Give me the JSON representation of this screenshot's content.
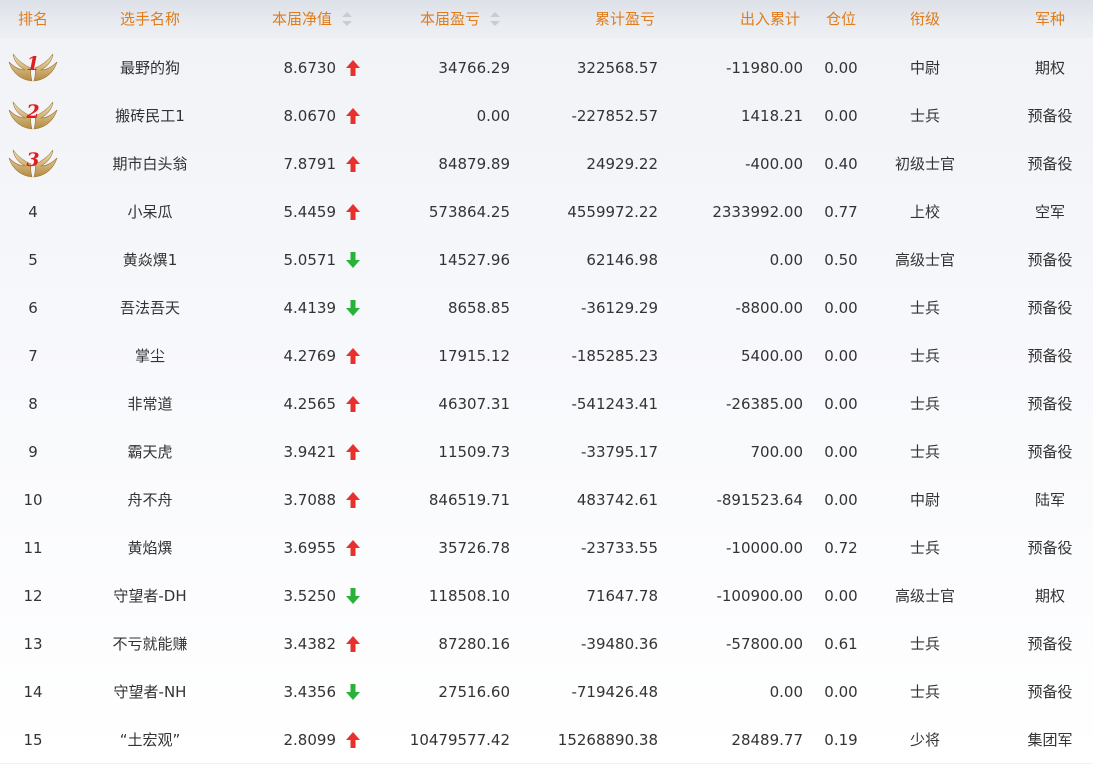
{
  "header": {
    "rank": "排名",
    "name": "选手名称",
    "nav": "本届净值",
    "pnl": "本届盈亏",
    "cum_pnl": "累计盈亏",
    "flow": "出入累计",
    "position": "仓位",
    "grade": "衔级",
    "branch": "军种"
  },
  "colors": {
    "header_text": "#e07c1a",
    "up": "#e8302c",
    "down": "#29b13a",
    "medal": "#e01e1e"
  },
  "rows": [
    {
      "rank": "1",
      "name": "最野的狗",
      "nav": "8.6730",
      "trend": "up",
      "pnl": "34766.29",
      "cum_pnl": "322568.57",
      "flow": "-11980.00",
      "position": "0.00",
      "grade": "中尉",
      "branch": "期权"
    },
    {
      "rank": "2",
      "name": "搬砖民工1",
      "nav": "8.0670",
      "trend": "up",
      "pnl": "0.00",
      "cum_pnl": "-227852.57",
      "flow": "1418.21",
      "position": "0.00",
      "grade": "士兵",
      "branch": "预备役"
    },
    {
      "rank": "3",
      "name": "期市白头翁",
      "nav": "7.8791",
      "trend": "up",
      "pnl": "84879.89",
      "cum_pnl": "24929.22",
      "flow": "-400.00",
      "position": "0.40",
      "grade": "初级士官",
      "branch": "预备役"
    },
    {
      "rank": "4",
      "name": "小呆瓜",
      "nav": "5.4459",
      "trend": "up",
      "pnl": "573864.25",
      "cum_pnl": "4559972.22",
      "flow": "2333992.00",
      "position": "0.77",
      "grade": "上校",
      "branch": "空军"
    },
    {
      "rank": "5",
      "name": "黄焱熼1",
      "nav": "5.0571",
      "trend": "down",
      "pnl": "14527.96",
      "cum_pnl": "62146.98",
      "flow": "0.00",
      "position": "0.50",
      "grade": "高级士官",
      "branch": "预备役"
    },
    {
      "rank": "6",
      "name": "吾法吾天",
      "nav": "4.4139",
      "trend": "down",
      "pnl": "8658.85",
      "cum_pnl": "-36129.29",
      "flow": "-8800.00",
      "position": "0.00",
      "grade": "士兵",
      "branch": "预备役"
    },
    {
      "rank": "7",
      "name": "掌尘",
      "nav": "4.2769",
      "trend": "up",
      "pnl": "17915.12",
      "cum_pnl": "-185285.23",
      "flow": "5400.00",
      "position": "0.00",
      "grade": "士兵",
      "branch": "预备役"
    },
    {
      "rank": "8",
      "name": "非常道",
      "nav": "4.2565",
      "trend": "up",
      "pnl": "46307.31",
      "cum_pnl": "-541243.41",
      "flow": "-26385.00",
      "position": "0.00",
      "grade": "士兵",
      "branch": "预备役"
    },
    {
      "rank": "9",
      "name": "霸天虎",
      "nav": "3.9421",
      "trend": "up",
      "pnl": "11509.73",
      "cum_pnl": "-33795.17",
      "flow": "700.00",
      "position": "0.00",
      "grade": "士兵",
      "branch": "预备役"
    },
    {
      "rank": "10",
      "name": "舟不舟",
      "nav": "3.7088",
      "trend": "up",
      "pnl": "846519.71",
      "cum_pnl": "483742.61",
      "flow": "-891523.64",
      "position": "0.00",
      "grade": "中尉",
      "branch": "陆军"
    },
    {
      "rank": "11",
      "name": "黄焰熼",
      "nav": "3.6955",
      "trend": "up",
      "pnl": "35726.78",
      "cum_pnl": "-23733.55",
      "flow": "-10000.00",
      "position": "0.72",
      "grade": "士兵",
      "branch": "预备役"
    },
    {
      "rank": "12",
      "name": "守望者-DH",
      "nav": "3.5250",
      "trend": "down",
      "pnl": "118508.10",
      "cum_pnl": "71647.78",
      "flow": "-100900.00",
      "position": "0.00",
      "grade": "高级士官",
      "branch": "期权"
    },
    {
      "rank": "13",
      "name": "不亏就能赚",
      "nav": "3.4382",
      "trend": "up",
      "pnl": "87280.16",
      "cum_pnl": "-39480.36",
      "flow": "-57800.00",
      "position": "0.61",
      "grade": "士兵",
      "branch": "预备役"
    },
    {
      "rank": "14",
      "name": "守望者-NH",
      "nav": "3.4356",
      "trend": "down",
      "pnl": "27516.60",
      "cum_pnl": "-719426.48",
      "flow": "0.00",
      "position": "0.00",
      "grade": "士兵",
      "branch": "预备役"
    },
    {
      "rank": "15",
      "name": "“土宏观”",
      "nav": "2.8099",
      "trend": "up",
      "pnl": "10479577.42",
      "cum_pnl": "15268890.38",
      "flow": "28489.77",
      "position": "0.19",
      "grade": "少将",
      "branch": "集团军"
    }
  ]
}
